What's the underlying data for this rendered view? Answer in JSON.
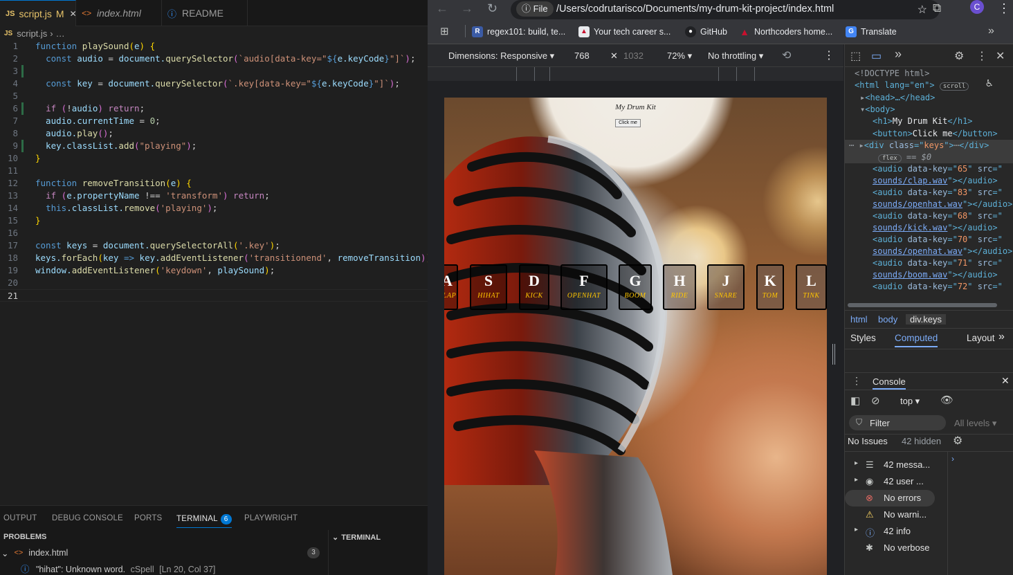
{
  "editor": {
    "tabs": [
      {
        "icon": "JS",
        "label": "script.js",
        "status": "M",
        "close": "✕"
      },
      {
        "icon": "<>",
        "label": "index.html"
      },
      {
        "icon": "ⓘ",
        "label": "README"
      }
    ],
    "breadcrumb": {
      "file": "script.js",
      "rest": "…"
    },
    "code": {
      "line_numbers": [
        "1",
        "2",
        "3",
        "4",
        "5",
        "6",
        "7",
        "8",
        "9",
        "10",
        "11",
        "12",
        "13",
        "14",
        "15",
        "16",
        "17",
        "18",
        "19",
        "20",
        "21"
      ]
    },
    "panel_tabs": {
      "output": "OUTPUT",
      "debug": "DEBUG CONSOLE",
      "ports": "PORTS",
      "terminal": "TERMINAL",
      "terminal_count": "6",
      "playwright": "PLAYWRIGHT"
    },
    "problems": {
      "header": "PROBLEMS",
      "terminal_header": "TERMINAL",
      "file": "index.html",
      "count": "3",
      "message": "\"hihat\": Unknown word.",
      "source": "cSpell",
      "location": "[Ln 20, Col 37]"
    }
  },
  "browser": {
    "file_chip": "File",
    "url": "/Users/codrutarisco/Documents/my-drum-kit-project/index.html",
    "avatar": "C",
    "bookmarks": [
      {
        "label": "regex101: build, te...",
        "fav": "R",
        "color": "#3b5ba5"
      },
      {
        "label": "Your tech career s...",
        "fav": "▲",
        "color": "#ffffff"
      },
      {
        "label": "GitHub",
        "fav": "●",
        "color": "#ffffff"
      },
      {
        "label": "Northcoders home...",
        "fav": "▲",
        "color": "#c8102e"
      },
      {
        "label": "Translate",
        "fav": "G",
        "color": "#4285f4"
      }
    ],
    "device_toolbar": {
      "dimensions": "Dimensions: Responsive ▾",
      "width": "768",
      "x": "✕",
      "height": "1032",
      "zoom": "72% ▾",
      "throttling": "No throttling ▾"
    },
    "page": {
      "title": "My Drum Kit",
      "button": "Click me",
      "keys": [
        {
          "key": "A",
          "sound": "CLAP"
        },
        {
          "key": "S",
          "sound": "HIHAT"
        },
        {
          "key": "D",
          "sound": "KICK"
        },
        {
          "key": "F",
          "sound": "OPENHAT"
        },
        {
          "key": "G",
          "sound": "BOOM"
        },
        {
          "key": "H",
          "sound": "RIDE"
        },
        {
          "key": "J",
          "sound": "SNARE"
        },
        {
          "key": "K",
          "sound": "TOM"
        },
        {
          "key": "L",
          "sound": "TINK"
        }
      ]
    }
  },
  "devtools": {
    "elements": {
      "doctype": "<!DOCTYPE html>",
      "html_open": "<html lang=\"en\">",
      "scroll_badge": "scroll",
      "head": "<head>…</head>",
      "body_open": "<body>",
      "h1": "My Drum Kit",
      "button": "Click me",
      "div_class": "keys",
      "flex_badge": "flex",
      "dollar": "== $0",
      "audios": [
        {
          "key": "65",
          "file": "sounds/clap.wav"
        },
        {
          "key": "83",
          "file": "sounds/openhat.wav"
        },
        {
          "key": "68",
          "file": "sounds/kick.wav"
        },
        {
          "key": "70",
          "file": "sounds/openhat.wav"
        },
        {
          "key": "71",
          "file": "sounds/boom.wav"
        },
        {
          "key": "72",
          "file": ""
        }
      ]
    },
    "breadcrumbs": [
      "html",
      "body",
      "div.keys"
    ],
    "style_tabs": {
      "styles": "Styles",
      "computed": "Computed",
      "layout": "Layout"
    },
    "console": {
      "title": "Console",
      "context": "top ▾",
      "filter": "Filter",
      "levels": "All levels ▾",
      "issues": "No Issues",
      "hidden": "42 hidden",
      "messages": [
        {
          "label": "42 messa...",
          "icon": "list-icon"
        },
        {
          "label": "42 user ...",
          "icon": "user-icon"
        },
        {
          "label": "No errors",
          "icon": "error-icon"
        },
        {
          "label": "No warni...",
          "icon": "warning-icon"
        },
        {
          "label": "42 info",
          "icon": "info-icon"
        },
        {
          "label": "No verbose",
          "icon": "bug-icon"
        }
      ]
    }
  }
}
